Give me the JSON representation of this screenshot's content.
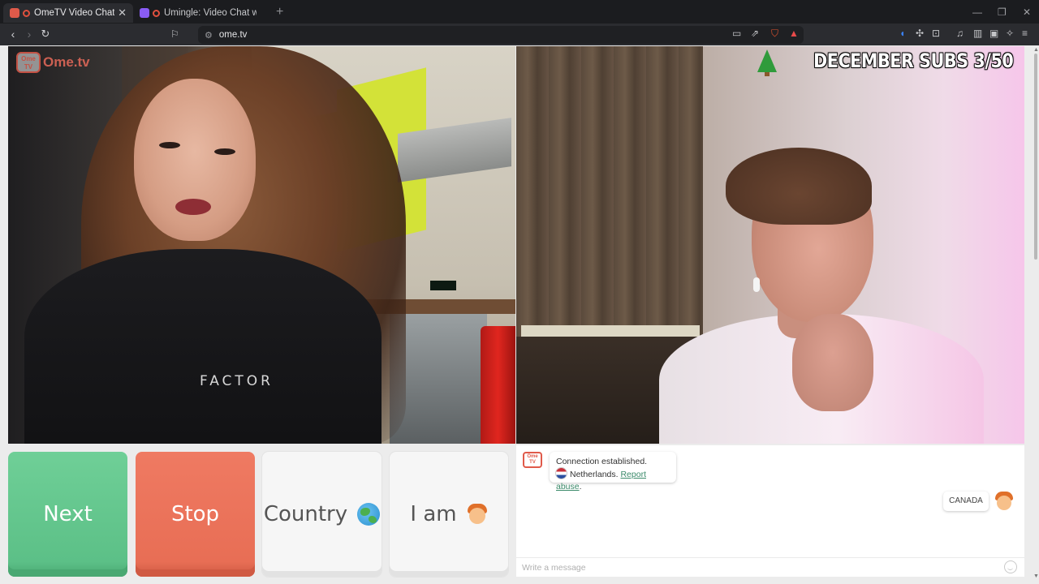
{
  "browser": {
    "tabs": [
      {
        "title": "OmeTV Video Chat — Omegle",
        "active": true,
        "favicon_color": "#e05a4a"
      },
      {
        "title": "Umingle: Video Chat with Strangers",
        "active": false,
        "favicon_color": "#8a5cf6"
      }
    ],
    "new_tab_icon": "plus-icon",
    "url": "ome.tv"
  },
  "logo": {
    "badge": "Ome TV",
    "text": "Ome.tv"
  },
  "overlay": {
    "banner": "DECEMBER SUBS 3/50",
    "icon": "christmas-tree-icon"
  },
  "left_video": {
    "hoodie_text": "FACTOR"
  },
  "buttons": {
    "next": "Next",
    "stop": "Stop",
    "country": "Country",
    "country_icon": "globe-icon",
    "iam": "I am",
    "iam_icon": "boy-icon"
  },
  "chat": {
    "status": "Connection established.",
    "country": "Netherlands.",
    "report": "Report abuse",
    "report_suffix": ".",
    "partner_country": "CANADA",
    "placeholder": "Write a message"
  },
  "colors": {
    "next": "#5cc087",
    "stop": "#e86e55",
    "accent": "#e05a4a",
    "link": "#3b8a6a"
  }
}
